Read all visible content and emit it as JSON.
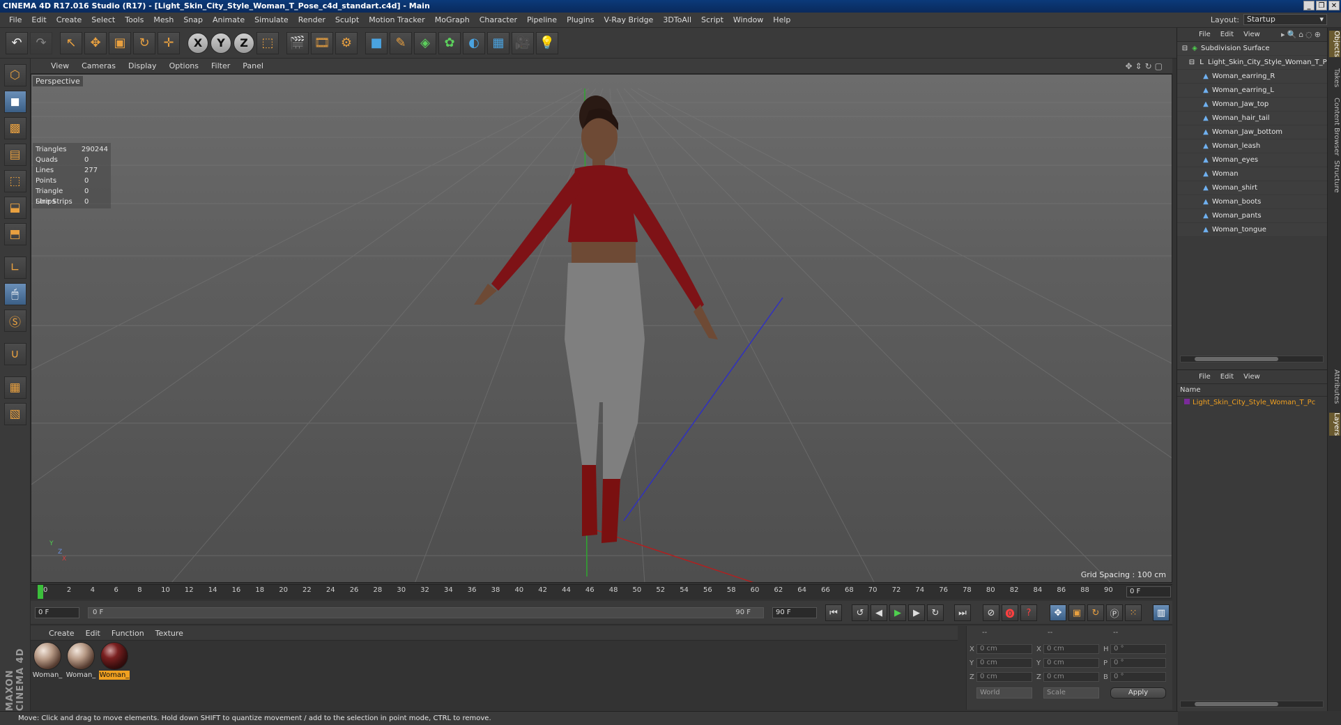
{
  "window": {
    "title": "CINEMA 4D R17.016 Studio (R17) - [Light_Skin_City_Style_Woman_T_Pose_c4d_standart.c4d] - Main"
  },
  "menubar": {
    "items": [
      "File",
      "Edit",
      "Create",
      "Select",
      "Tools",
      "Mesh",
      "Snap",
      "Animate",
      "Simulate",
      "Render",
      "Sculpt",
      "Motion Tracker",
      "MoGraph",
      "Character",
      "Pipeline",
      "Plugins",
      "V-Ray Bridge",
      "3DToAll",
      "Script",
      "Window",
      "Help"
    ],
    "layout_label": "Layout:",
    "layout_value": "Startup"
  },
  "viewport": {
    "menu": [
      "View",
      "Cameras",
      "Display",
      "Options",
      "Filter",
      "Panel"
    ],
    "label": "Perspective",
    "stats": [
      {
        "k": "Triangles",
        "v": "290244"
      },
      {
        "k": "Quads",
        "v": "0"
      },
      {
        "k": "Lines",
        "v": "277"
      },
      {
        "k": "Points",
        "v": "0"
      },
      {
        "k": "Triangle Strips",
        "v": "0"
      },
      {
        "k": "Line Strips",
        "v": "0"
      }
    ],
    "grid_spacing": "Grid Spacing : 100 cm",
    "axis_labels": {
      "y": "Y",
      "z": "Z",
      "x": "X"
    }
  },
  "timeline": {
    "ticks": [
      "0",
      "2",
      "4",
      "6",
      "8",
      "10",
      "12",
      "14",
      "16",
      "18",
      "20",
      "22",
      "24",
      "26",
      "28",
      "30",
      "32",
      "34",
      "36",
      "38",
      "40",
      "42",
      "44",
      "46",
      "48",
      "50",
      "52",
      "54",
      "56",
      "58",
      "60",
      "62",
      "64",
      "66",
      "68",
      "70",
      "72",
      "74",
      "76",
      "78",
      "80",
      "82",
      "84",
      "86",
      "88",
      "90"
    ],
    "current_frame": "0 F",
    "start_field": "0 F",
    "range_start": "0 F",
    "range_end": "90 F",
    "end_field": "90 F"
  },
  "materials": {
    "menu": [
      "Create",
      "Edit",
      "Function",
      "Texture"
    ],
    "items": [
      {
        "label": "Woman_",
        "selected": false,
        "dark": false
      },
      {
        "label": "Woman_",
        "selected": false,
        "dark": false
      },
      {
        "label": "Woman_",
        "selected": true,
        "dark": true
      }
    ]
  },
  "coordinates": {
    "header": [
      "--",
      "--",
      "--"
    ],
    "rows": [
      {
        "a": "X",
        "av": "0 cm",
        "b": "X",
        "bv": "0 cm",
        "c": "H",
        "cv": "0 °"
      },
      {
        "a": "Y",
        "av": "0 cm",
        "b": "Y",
        "bv": "0 cm",
        "c": "P",
        "cv": "0 °"
      },
      {
        "a": "Z",
        "av": "0 cm",
        "b": "Z",
        "bv": "0 cm",
        "c": "B",
        "cv": "0 °"
      }
    ],
    "space": "World",
    "mode": "Scale",
    "apply": "Apply"
  },
  "status": "Move: Click and drag to move elements. Hold down SHIFT to quantize movement / add to the selection in point mode, CTRL to remove.",
  "objects": {
    "menu": [
      "File",
      "Edit",
      "View"
    ],
    "root": "Subdivision Surface",
    "group": "Light_Skin_City_Style_Woman_T_P",
    "children": [
      "Woman_earring_R",
      "Woman_earring_L",
      "Woman_Jaw_top",
      "Woman_hair_tail",
      "Woman_Jaw_bottom",
      "Woman_leash",
      "Woman_eyes",
      "Woman",
      "Woman_shirt",
      "Woman_boots",
      "Woman_pants",
      "Woman_tongue"
    ]
  },
  "layers": {
    "menu": [
      "File",
      "Edit",
      "View"
    ],
    "name_header": "Name",
    "rows": [
      "Light_Skin_City_Style_Woman_T_Pc"
    ]
  },
  "sidetabs": [
    "Objects",
    "Takes",
    "Content Browser",
    "Structure",
    "Attributes",
    "Layers"
  ],
  "brand": "MAXON CINEMA 4D"
}
